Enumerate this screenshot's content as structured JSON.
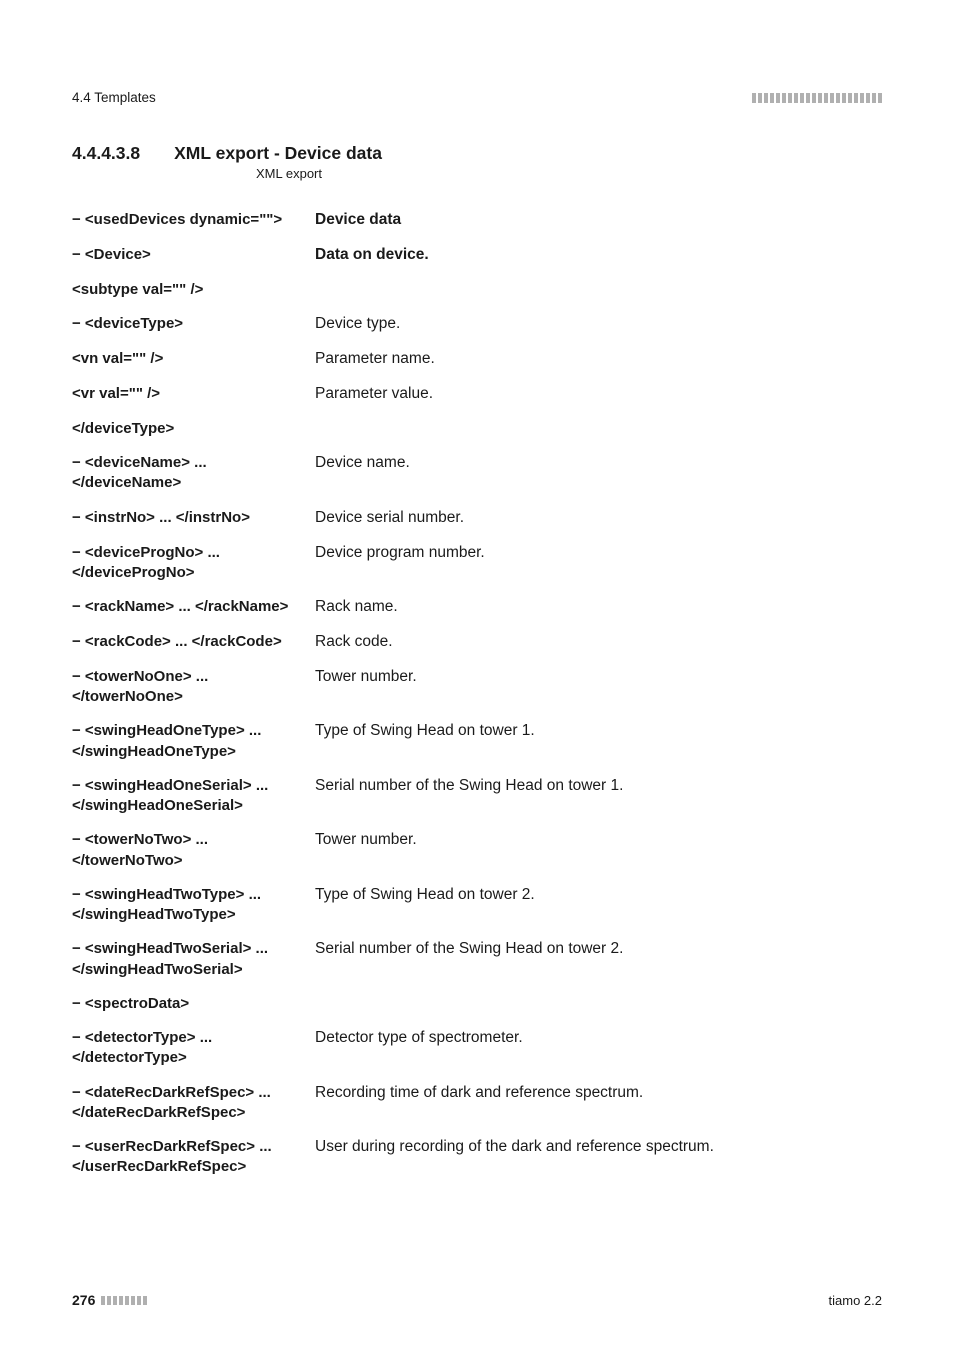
{
  "header": {
    "section": "4.4 Templates"
  },
  "section": {
    "number": "4.4.4.3.8",
    "title": "XML export - Device data",
    "subtitle": "XML export"
  },
  "rows": [
    {
      "xml": "− <usedDevices dynamic=\"\">",
      "desc": "Device data",
      "bold": true
    },
    {
      "xml": "− <Device>",
      "desc": "Data on device.",
      "bold": true
    },
    {
      "xml": "<subtype val=\"\" />",
      "desc": ""
    },
    {
      "xml": "− <deviceType>",
      "desc": "Device type."
    },
    {
      "xml": "<vn val=\"\" />",
      "desc": "Parameter name."
    },
    {
      "xml": "<vr val=\"\" />",
      "desc": "Parameter value."
    },
    {
      "xml": "</deviceType>",
      "desc": ""
    },
    {
      "xml": "− <deviceName> ... </deviceName>",
      "desc": "Device name."
    },
    {
      "xml": "− <instrNo> ... </instrNo>",
      "desc": "Device serial number."
    },
    {
      "xml": "− <deviceProgNo> ... </deviceProgNo>",
      "desc": "Device program number."
    },
    {
      "xml": "− <rackName> ... </rackName>",
      "desc": "Rack name."
    },
    {
      "xml": "− <rackCode> ... </rackCode>",
      "desc": "Rack code."
    },
    {
      "xml": "− <towerNoOne> ... </towerNoOne>",
      "desc": "Tower number."
    },
    {
      "xml": "− <swingHeadOneType> ... </swingHeadOneType>",
      "desc": "Type of Swing Head on tower 1."
    },
    {
      "xml": "− <swingHeadOneSerial> ... </swingHeadOneSerial>",
      "desc": "Serial number of the Swing Head on tower 1."
    },
    {
      "xml": "− <towerNoTwo> ... </towerNoTwo>",
      "desc": "Tower number."
    },
    {
      "xml": "− <swingHeadTwoType> ... </swingHeadTwoType>",
      "desc": "Type of Swing Head on tower 2."
    },
    {
      "xml": "− <swingHeadTwoSerial> ... </swingHeadTwoSerial>",
      "desc": "Serial number of the Swing Head on tower 2."
    },
    {
      "xml": "− <spectroData>",
      "desc": ""
    },
    {
      "xml": "− <detectorType> ... </detectorType>",
      "desc": "Detector type of spectrometer."
    },
    {
      "xml": "− <dateRecDarkRefSpec> ... </dateRecDarkRefSpec>",
      "desc": "Recording time of dark and reference spectrum."
    },
    {
      "xml": "− <userRecDarkRefSpec> ... </userRecDarkRefSpec>",
      "desc": "User during recording of the dark and reference spectrum."
    }
  ],
  "footer": {
    "page": "276",
    "app": "tiamo 2.2"
  }
}
